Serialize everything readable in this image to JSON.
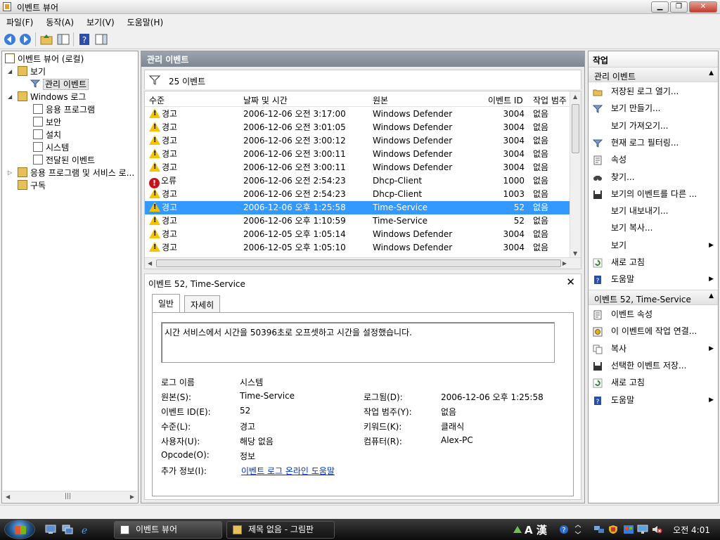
{
  "window": {
    "title": "이벤트 뷰어"
  },
  "menu": [
    "파일(F)",
    "동작(A)",
    "보기(V)",
    "도움말(H)"
  ],
  "tree": {
    "root": "이벤트 뷰어 (로컬)",
    "view": "보기",
    "admin_events": "관리 이벤트",
    "windows_logs": "Windows 로그",
    "application": "응용 프로그램",
    "security": "보안",
    "setup": "설치",
    "system": "시스템",
    "forwarded": "전달된 이벤트",
    "app_services": "응용 프로그램 및 서비스 로...",
    "subscriptions": "구독"
  },
  "center": {
    "header": "관리 이벤트",
    "filter_label": "25 이벤트",
    "columns": {
      "level": "수준",
      "datetime": "날짜 및 시간",
      "source": "원본",
      "event_id": "이벤트 ID",
      "category": "작업 범주"
    },
    "rows": [
      {
        "level": "경고",
        "icon": "warning",
        "datetime": "2006-12-06 오전 3:17:00",
        "source": "Windows Defender",
        "event_id": "3004",
        "category": "없음"
      },
      {
        "level": "경고",
        "icon": "warning",
        "datetime": "2006-12-06 오전 3:01:05",
        "source": "Windows Defender",
        "event_id": "3004",
        "category": "없음"
      },
      {
        "level": "경고",
        "icon": "warning",
        "datetime": "2006-12-06 오전 3:00:12",
        "source": "Windows Defender",
        "event_id": "3004",
        "category": "없음"
      },
      {
        "level": "경고",
        "icon": "warning",
        "datetime": "2006-12-06 오전 3:00:11",
        "source": "Windows Defender",
        "event_id": "3004",
        "category": "없음"
      },
      {
        "level": "경고",
        "icon": "warning",
        "datetime": "2006-12-06 오전 3:00:11",
        "source": "Windows Defender",
        "event_id": "3004",
        "category": "없음"
      },
      {
        "level": "오류",
        "icon": "error",
        "datetime": "2006-12-06 오전 2:54:23",
        "source": "Dhcp-Client",
        "event_id": "1000",
        "category": "없음"
      },
      {
        "level": "경고",
        "icon": "warning",
        "datetime": "2006-12-06 오전 2:54:23",
        "source": "Dhcp-Client",
        "event_id": "1003",
        "category": "없음"
      },
      {
        "level": "경고",
        "icon": "warning",
        "datetime": "2006-12-06 오후 1:25:58",
        "source": "Time-Service",
        "event_id": "52",
        "category": "없음",
        "selected": true
      },
      {
        "level": "경고",
        "icon": "warning",
        "datetime": "2006-12-06 오후 1:10:59",
        "source": "Time-Service",
        "event_id": "52",
        "category": "없음"
      },
      {
        "level": "경고",
        "icon": "warning",
        "datetime": "2006-12-05 오후 1:05:14",
        "source": "Windows Defender",
        "event_id": "3004",
        "category": "없음"
      },
      {
        "level": "경고",
        "icon": "warning",
        "datetime": "2006-12-05 오후 1:05:10",
        "source": "Windows Defender",
        "event_id": "3004",
        "category": "없음"
      }
    ]
  },
  "detail": {
    "title": "이벤트 52, Time-Service",
    "tabs": [
      "일반",
      "자세히"
    ],
    "message": "시간 서비스에서 시간을 50396초로 오프셋하고 시간을 설정했습니다.",
    "props": {
      "log_name_label": "로그 이름",
      "log_name": "시스템",
      "source_label": "원본(S):",
      "source": "Time-Service",
      "logged_label": "로그됨(D):",
      "logged": "2006-12-06 오후 1:25:58",
      "event_id_label": "이벤트 ID(E):",
      "event_id": "52",
      "category_label": "작업 범주(Y):",
      "category": "없음",
      "level_label": "수준(L):",
      "level": "경고",
      "keywords_label": "키워드(K):",
      "keywords": "클래식",
      "user_label": "사용자(U):",
      "user": "해당 없음",
      "computer_label": "컴퓨터(R):",
      "computer": "Alex-PC",
      "opcode_label": "Opcode(O):",
      "opcode": "정보",
      "more_label": "추가 정보(I):",
      "more_link": "이벤트 로그 온라인 도움말"
    }
  },
  "actions": {
    "header": "작업",
    "section1": "관리 이벤트",
    "items1": [
      {
        "label": "저장된 로그 열기...",
        "icon": "folder-open-icon"
      },
      {
        "label": "보기 만들기...",
        "icon": "filter-icon"
      },
      {
        "label": "보기 가져오기...",
        "icon": ""
      },
      {
        "label": "현재 로그 필터링...",
        "icon": "filter-icon"
      },
      {
        "label": "속성",
        "icon": "properties-icon"
      },
      {
        "label": "찾기...",
        "icon": "find-icon"
      },
      {
        "label": "보기의 이벤트를 다른 ...",
        "icon": "save-icon"
      },
      {
        "label": "보기 내보내기...",
        "icon": ""
      },
      {
        "label": "보기 복사...",
        "icon": ""
      },
      {
        "label": "보기",
        "icon": "",
        "submenu": true
      },
      {
        "label": "새로 고침",
        "icon": "refresh-icon"
      },
      {
        "label": "도움말",
        "icon": "help-icon",
        "submenu": true
      }
    ],
    "section2": "이벤트 52, Time-Service",
    "items2": [
      {
        "label": "이벤트 속성",
        "icon": "properties-icon"
      },
      {
        "label": "이 이벤트에 작업 연결...",
        "icon": "attach-task-icon"
      },
      {
        "label": "복사",
        "icon": "copy-icon",
        "submenu": true
      },
      {
        "label": "선택한 이벤트 저장...",
        "icon": "save-icon"
      },
      {
        "label": "새로 고침",
        "icon": "refresh-icon"
      },
      {
        "label": "도움말",
        "icon": "help-icon",
        "submenu": true
      }
    ]
  },
  "taskbar": {
    "buttons": [
      {
        "label": "이벤트 뷰어",
        "active": true
      },
      {
        "label": "제목 없음 - 그림판",
        "active": false
      }
    ],
    "ime": "A 漢",
    "clock": "오전 4:01"
  }
}
